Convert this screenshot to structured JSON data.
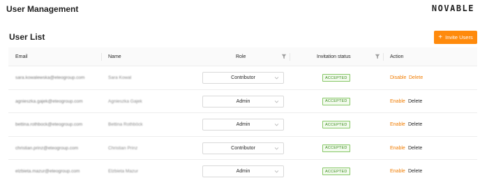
{
  "header": {
    "title": "User Management",
    "logo": "NOVABLE"
  },
  "section": {
    "title": "User List",
    "invite_label": "Invite Users"
  },
  "columns": {
    "email": "Email",
    "name": "Name",
    "role": "Role",
    "status": "Invitation status",
    "action": "Action"
  },
  "rows": [
    {
      "email": "sara.kowalewska@eteogroup.com",
      "name": "Sara Kowal",
      "role": "Contributor",
      "status": "ACCEPTED",
      "action1": "Disable",
      "action2": "Delete"
    },
    {
      "email": "agnieszka.gajek@eteogroup.com",
      "name": "Agnieszka Gajek",
      "role": "Admin",
      "status": "ACCEPTED",
      "action1": "Enable",
      "action2": "Delete"
    },
    {
      "email": "bettina.rothbock@eteogroup.com",
      "name": "Bettina Rothböck",
      "role": "Admin",
      "status": "ACCEPTED",
      "action1": "Enable",
      "action2": "Delete"
    },
    {
      "email": "christian.prinz@eteogroup.com",
      "name": "Christian Prinz",
      "role": "Contributor",
      "status": "ACCEPTED",
      "action1": "Enable",
      "action2": "Delete"
    },
    {
      "email": "elzbieta.mazur@eteogroup.com",
      "name": "Elzbieta Mazur",
      "role": "Admin",
      "status": "ACCEPTED",
      "action1": "Enable",
      "action2": "Delete"
    }
  ],
  "colors": {
    "accent": "#ff8a0c",
    "badge_green": "#3c8d1f"
  }
}
